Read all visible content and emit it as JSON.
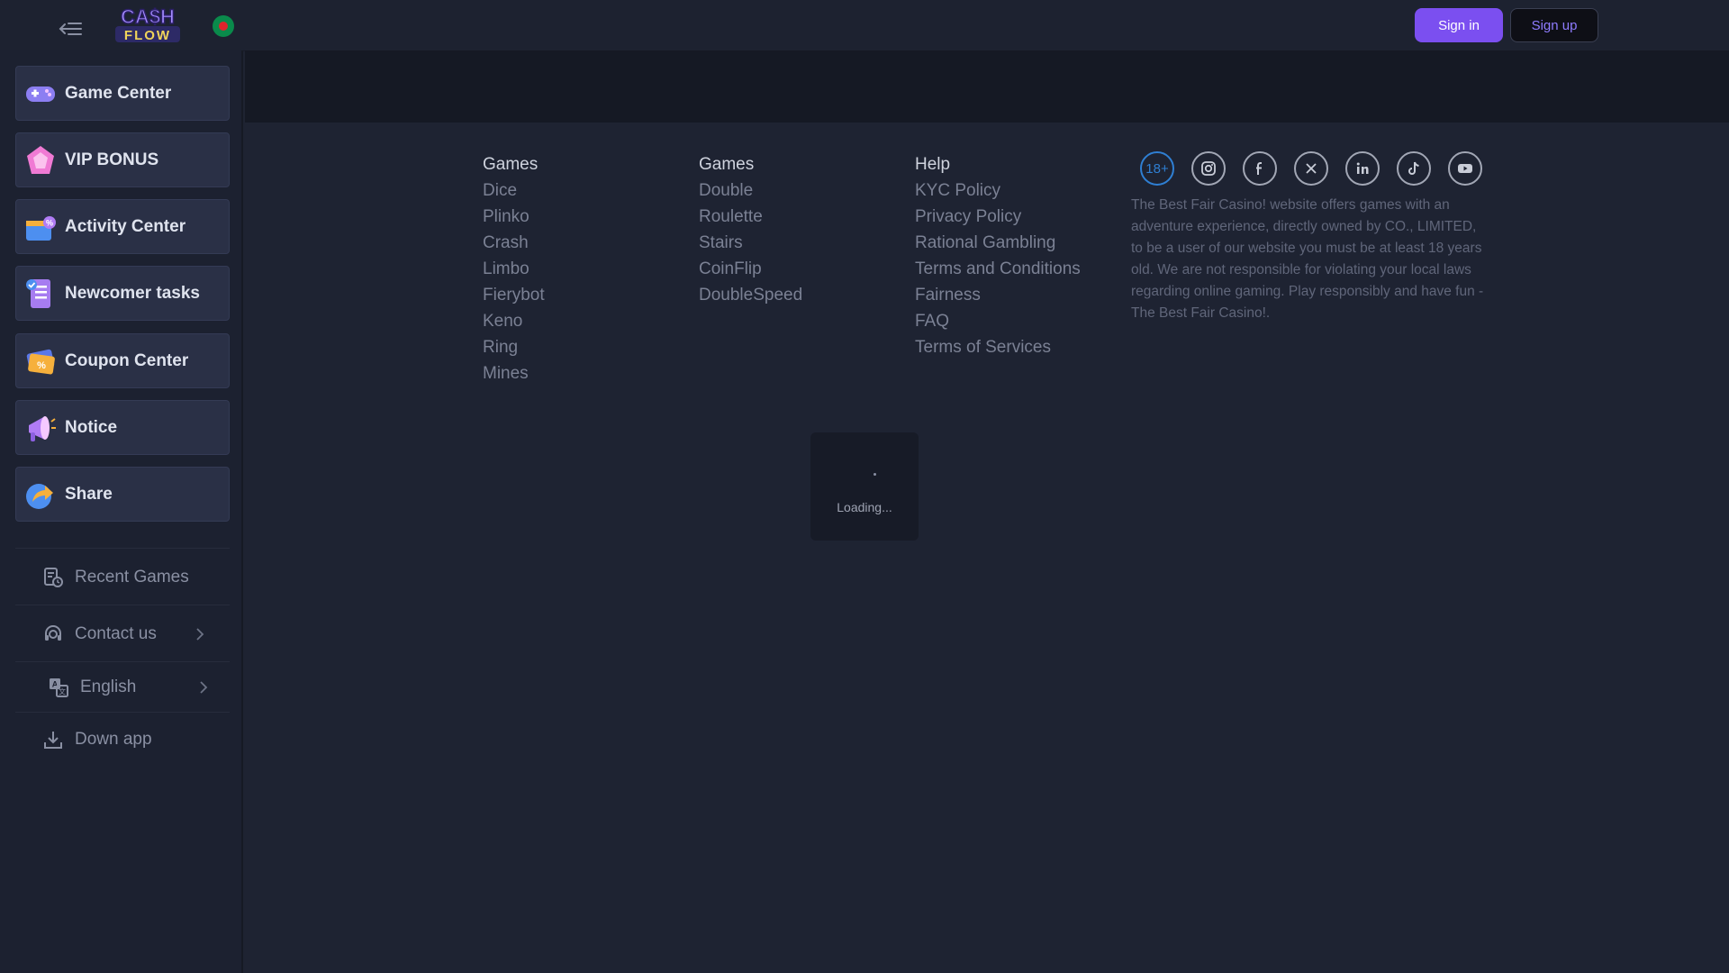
{
  "header": {
    "logo_text": "CASH FLOW",
    "sign_in": "Sign in",
    "sign_up": "Sign up"
  },
  "sidebar": {
    "features": [
      {
        "label": "Game Center",
        "icon": "gamepad-icon"
      },
      {
        "label": "VIP BONUS",
        "icon": "diamond-icon"
      },
      {
        "label": "Activity Center",
        "icon": "gift-box-icon"
      },
      {
        "label": "Newcomer tasks",
        "icon": "task-list-icon"
      },
      {
        "label": "Coupon Center",
        "icon": "coupon-icon"
      },
      {
        "label": "Notice",
        "icon": "megaphone-icon"
      },
      {
        "label": "Share",
        "icon": "share-icon"
      }
    ],
    "links": [
      {
        "label": "Recent Games",
        "icon": "recent-games-icon"
      },
      {
        "label": "Contact us",
        "icon": "headset-icon"
      },
      {
        "label": "English",
        "icon": "translate-icon"
      },
      {
        "label": "Down app",
        "icon": "download-icon"
      }
    ]
  },
  "footer": {
    "columns": [
      {
        "title": "Games",
        "items": [
          "Dice",
          "Plinko",
          "Crash",
          "Limbo",
          "Fierybot",
          "Keno",
          "Ring",
          "Mines"
        ]
      },
      {
        "title": "Games",
        "items": [
          "Double",
          "Roulette",
          "Stairs",
          "CoinFlip",
          "DoubleSpeed"
        ]
      },
      {
        "title": "Help",
        "items": [
          "KYC Policy",
          "Privacy Policy",
          "Rational Gambling",
          "Terms and Conditions",
          "Fairness",
          "FAQ",
          "Terms of Services"
        ]
      }
    ],
    "age_badge": "18+",
    "socials": [
      "instagram-icon",
      "facebook-icon",
      "x-twitter-icon",
      "linkedin-icon",
      "tiktok-icon",
      "youtube-icon"
    ],
    "about": "The Best Fair Casino! website offers games with an adventure experience, directly owned by CO., LIMITED, to be a user of our website you must be at least 18 years old. We are not responsible for violating your local laws regarding online gaming. Play responsibly and have fun -The Best Fair Casino!."
  },
  "loading": {
    "text": "Loading..."
  },
  "colors": {
    "accent": "#7b4ff0",
    "background": "#1e2332",
    "sidebar": "#1c2130"
  }
}
